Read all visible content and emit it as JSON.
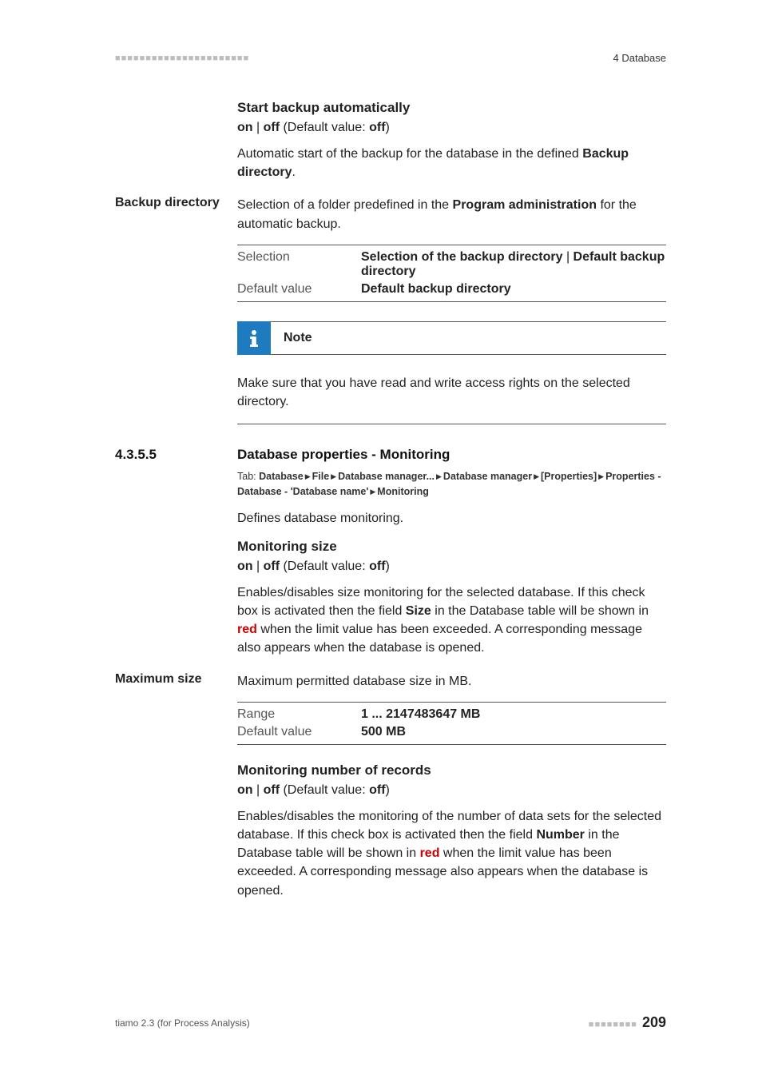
{
  "header": {
    "dots": "■■■■■■■■■■■■■■■■■■■■■■",
    "right": "4 Database"
  },
  "sec1": {
    "h": "Start backup automatically",
    "opt_on": "on",
    "opt_sep": " | ",
    "opt_off": "off",
    "opt_def_label": " (Default value: ",
    "opt_def_val": "off",
    "opt_close": ")",
    "p1a": "Automatic start of the backup for the database in the defined ",
    "p1b": "Backup directory",
    "p1c": "."
  },
  "sec2": {
    "side": "Backup directory",
    "p1a": "Selection of a folder predefined in the ",
    "p1b": "Program administration",
    "p1c": " for the automatic backup.",
    "row1_key": "Selection",
    "row1_val_a": "Selection of the backup directory",
    "row1_val_sep": " | ",
    "row1_val_b": "Default backup directory",
    "row2_key": "Default value",
    "row2_val": "Default backup directory"
  },
  "note": {
    "title": "Note",
    "body": "Make sure that you have read and write access rights on the selected directory."
  },
  "sec3": {
    "num": "4.3.5.5",
    "title": "Database properties - Monitoring",
    "tab_prefix": "Tab: ",
    "tp1": "Database",
    "tp2": "File",
    "tp3": "Database manager...",
    "tp4": "Database manager",
    "tp5": "[Properties]",
    "tp6": "Properties - Database - 'Database name'",
    "tp7": "Monitoring",
    "p_def": "Defines database monitoring.",
    "h": "Monitoring size",
    "opt_on": "on",
    "opt_sep": " | ",
    "opt_off": "off",
    "opt_def_label": " (Default value: ",
    "opt_def_val": "off",
    "opt_close": ")",
    "p2a": "Enables/disables size monitoring for the selected database. If this check box is activated then the field ",
    "p2b": "Size",
    "p2c": " in the Database table will be shown in ",
    "p2d": "red",
    "p2e": " when the limit value has been exceeded. A corresponding message also appears when the database is opened."
  },
  "sec4": {
    "side": "Maximum size",
    "p": "Maximum permitted database size in MB.",
    "row1_key": "Range",
    "row1_val": "1 ... 2147483647 MB",
    "row2_key": "Default value",
    "row2_val": "500 MB"
  },
  "sec5": {
    "h": "Monitoring number of records",
    "opt_on": "on",
    "opt_sep": " | ",
    "opt_off": "off",
    "opt_def_label": " (Default value: ",
    "opt_def_val": "off",
    "opt_close": ")",
    "p_a": "Enables/disables the monitoring of the number of data sets for the selected database. If this check box is activated then the field ",
    "p_b": "Number",
    "p_c": " in the Database table will be shown in ",
    "p_d": "red",
    "p_e": " when the limit value has been exceeded. A corresponding message also appears when the database is opened."
  },
  "footer": {
    "left": "tiamo 2.3 (for Process Analysis)",
    "dots": "■■■■■■■■",
    "page": "209"
  }
}
